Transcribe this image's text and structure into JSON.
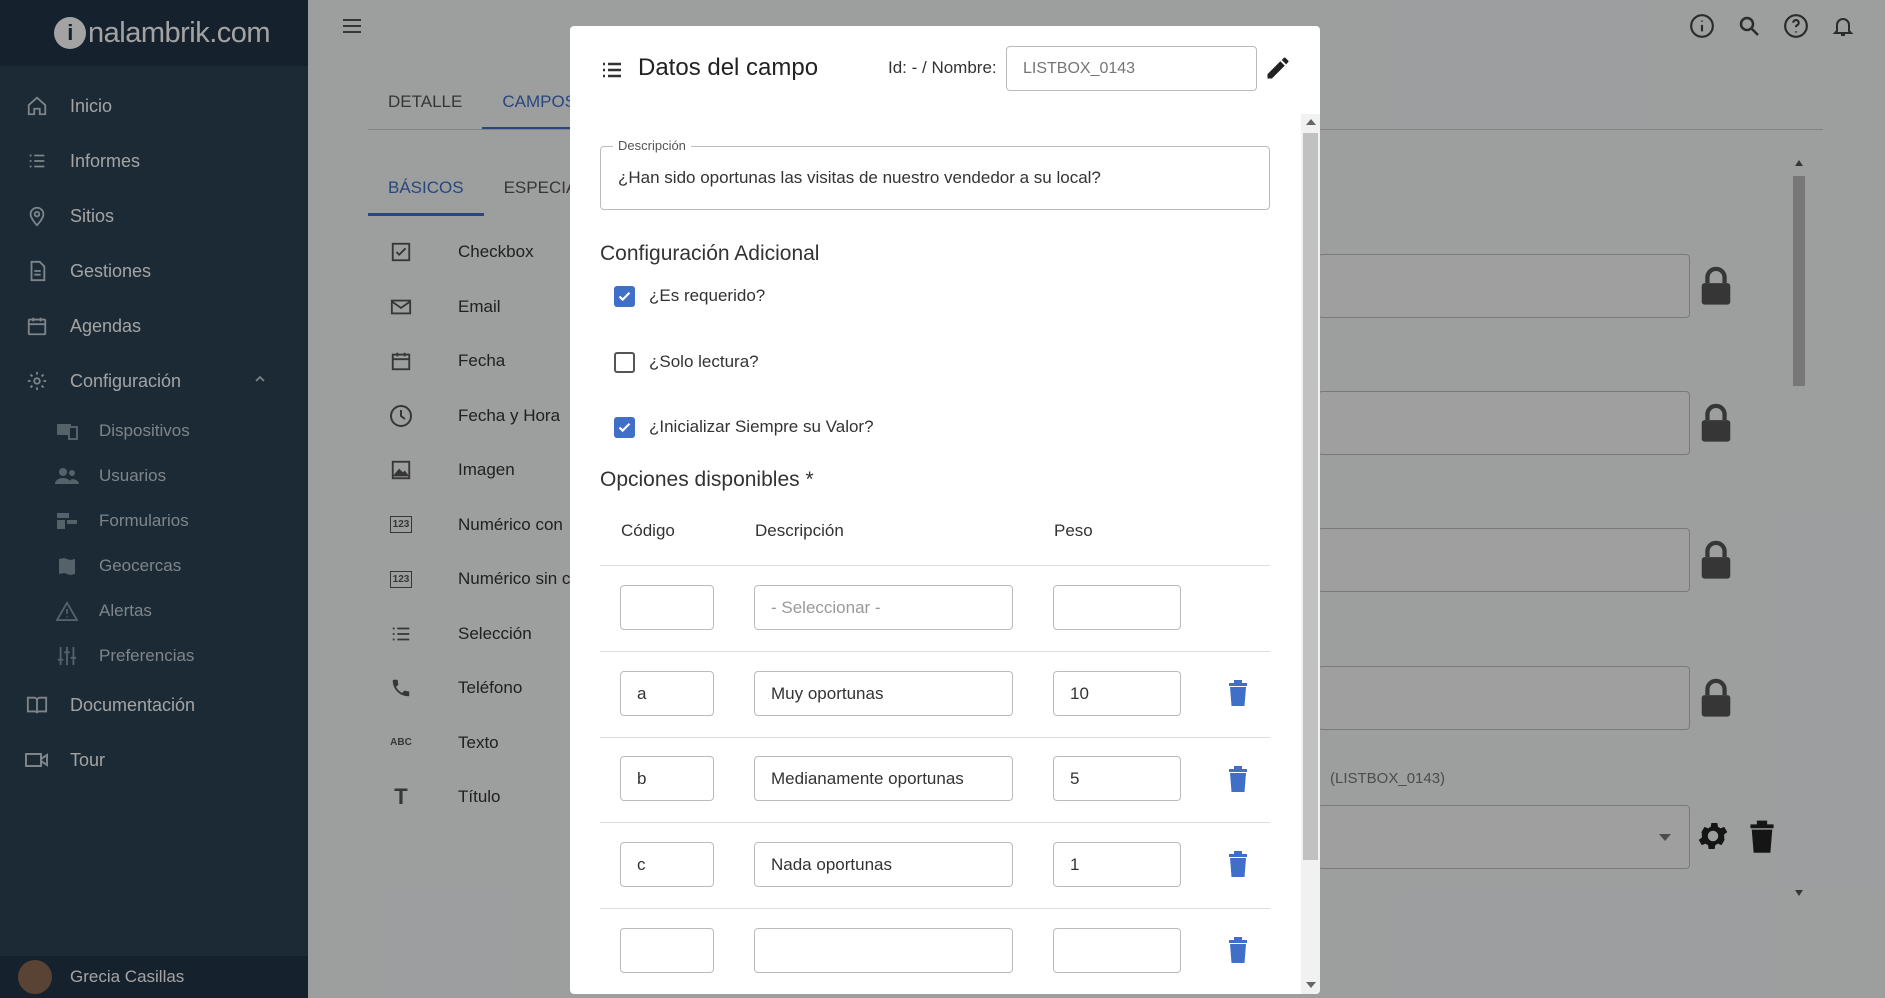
{
  "logo": {
    "brand": "inalambrik.com",
    "i": "i",
    "rest": "nalambrik.com"
  },
  "sidebar": {
    "items": [
      {
        "label": "Inicio",
        "icon": "home-icon"
      },
      {
        "label": "Informes",
        "icon": "list-icon"
      },
      {
        "label": "Sitios",
        "icon": "location-icon"
      },
      {
        "label": "Gestiones",
        "icon": "document-icon"
      },
      {
        "label": "Agendas",
        "icon": "calendar-icon"
      },
      {
        "label": "Configuración",
        "icon": "gear-icon",
        "expanded": true
      },
      {
        "label": "Dispositivos",
        "icon": "devices-icon",
        "sub": true
      },
      {
        "label": "Usuarios",
        "icon": "users-icon",
        "sub": true
      },
      {
        "label": "Formularios",
        "icon": "forms-icon",
        "sub": true
      },
      {
        "label": "Geocercas",
        "icon": "map-icon",
        "sub": true
      },
      {
        "label": "Alertas",
        "icon": "warning-icon",
        "sub": true
      },
      {
        "label": "Preferencias",
        "icon": "sliders-icon",
        "sub": true
      },
      {
        "label": "Documentación",
        "icon": "book-icon"
      },
      {
        "label": "Tour",
        "icon": "video-icon"
      }
    ],
    "user": "Grecia Casillas"
  },
  "main": {
    "tabs": [
      "DETALLE",
      "CAMPOS"
    ],
    "active_tab": "CAMPOS",
    "subtabs": [
      "BÁSICOS",
      "ESPECIA"
    ],
    "active_subtab": "BÁSICOS",
    "field_types": [
      {
        "label": "Checkbox",
        "icon": "checkbox-icon"
      },
      {
        "label": "Email",
        "icon": "email-icon"
      },
      {
        "label": "Fecha",
        "icon": "calendar-icon"
      },
      {
        "label": "Fecha y Hora",
        "icon": "clock-icon"
      },
      {
        "label": "Imagen",
        "icon": "image-icon"
      },
      {
        "label": "Numérico con",
        "icon": "numeric-icon",
        "glyph": "123"
      },
      {
        "label": "Numérico sin c",
        "icon": "numeric-icon",
        "glyph": "123"
      },
      {
        "label": "Selección",
        "icon": "list-icon"
      },
      {
        "label": "Teléfono",
        "icon": "phone-icon"
      },
      {
        "label": "Texto",
        "icon": "text-icon",
        "glyph": "ABC"
      },
      {
        "label": "Título",
        "icon": "title-icon",
        "glyph": "T"
      }
    ],
    "listbox_label": "(LISTBOX_0143)"
  },
  "modal": {
    "title": "Datos del campo",
    "id_label": "Id: - / Nombre:",
    "name_placeholder": "LISTBOX_0143",
    "description_label": "Descripción",
    "description_value": "¿Han sido oportunas las visitas de nuestro vendedor a su local?",
    "config_title": "Configuración Adicional",
    "checkboxes": [
      {
        "label": "¿Es requerido?",
        "checked": true
      },
      {
        "label": "¿Solo lectura?",
        "checked": false
      },
      {
        "label": "¿Inicializar Siempre su Valor?",
        "checked": true
      }
    ],
    "options_title": "Opciones disponibles *",
    "columns": [
      "Código",
      "Descripción",
      "Peso"
    ],
    "new_row": {
      "code": "",
      "description_placeholder": "- Seleccionar -",
      "weight": ""
    },
    "rows": [
      {
        "code": "a",
        "description": "Muy oportunas",
        "weight": "10"
      },
      {
        "code": "b",
        "description": "Medianamente oportunas",
        "weight": "5"
      },
      {
        "code": "c",
        "description": "Nada oportunas",
        "weight": "1"
      },
      {
        "code": "",
        "description": "",
        "weight": ""
      }
    ]
  },
  "colors": {
    "sidebar": "#2b4253",
    "accent": "#3f6fc6",
    "checkbox": "#3f6fc6"
  }
}
